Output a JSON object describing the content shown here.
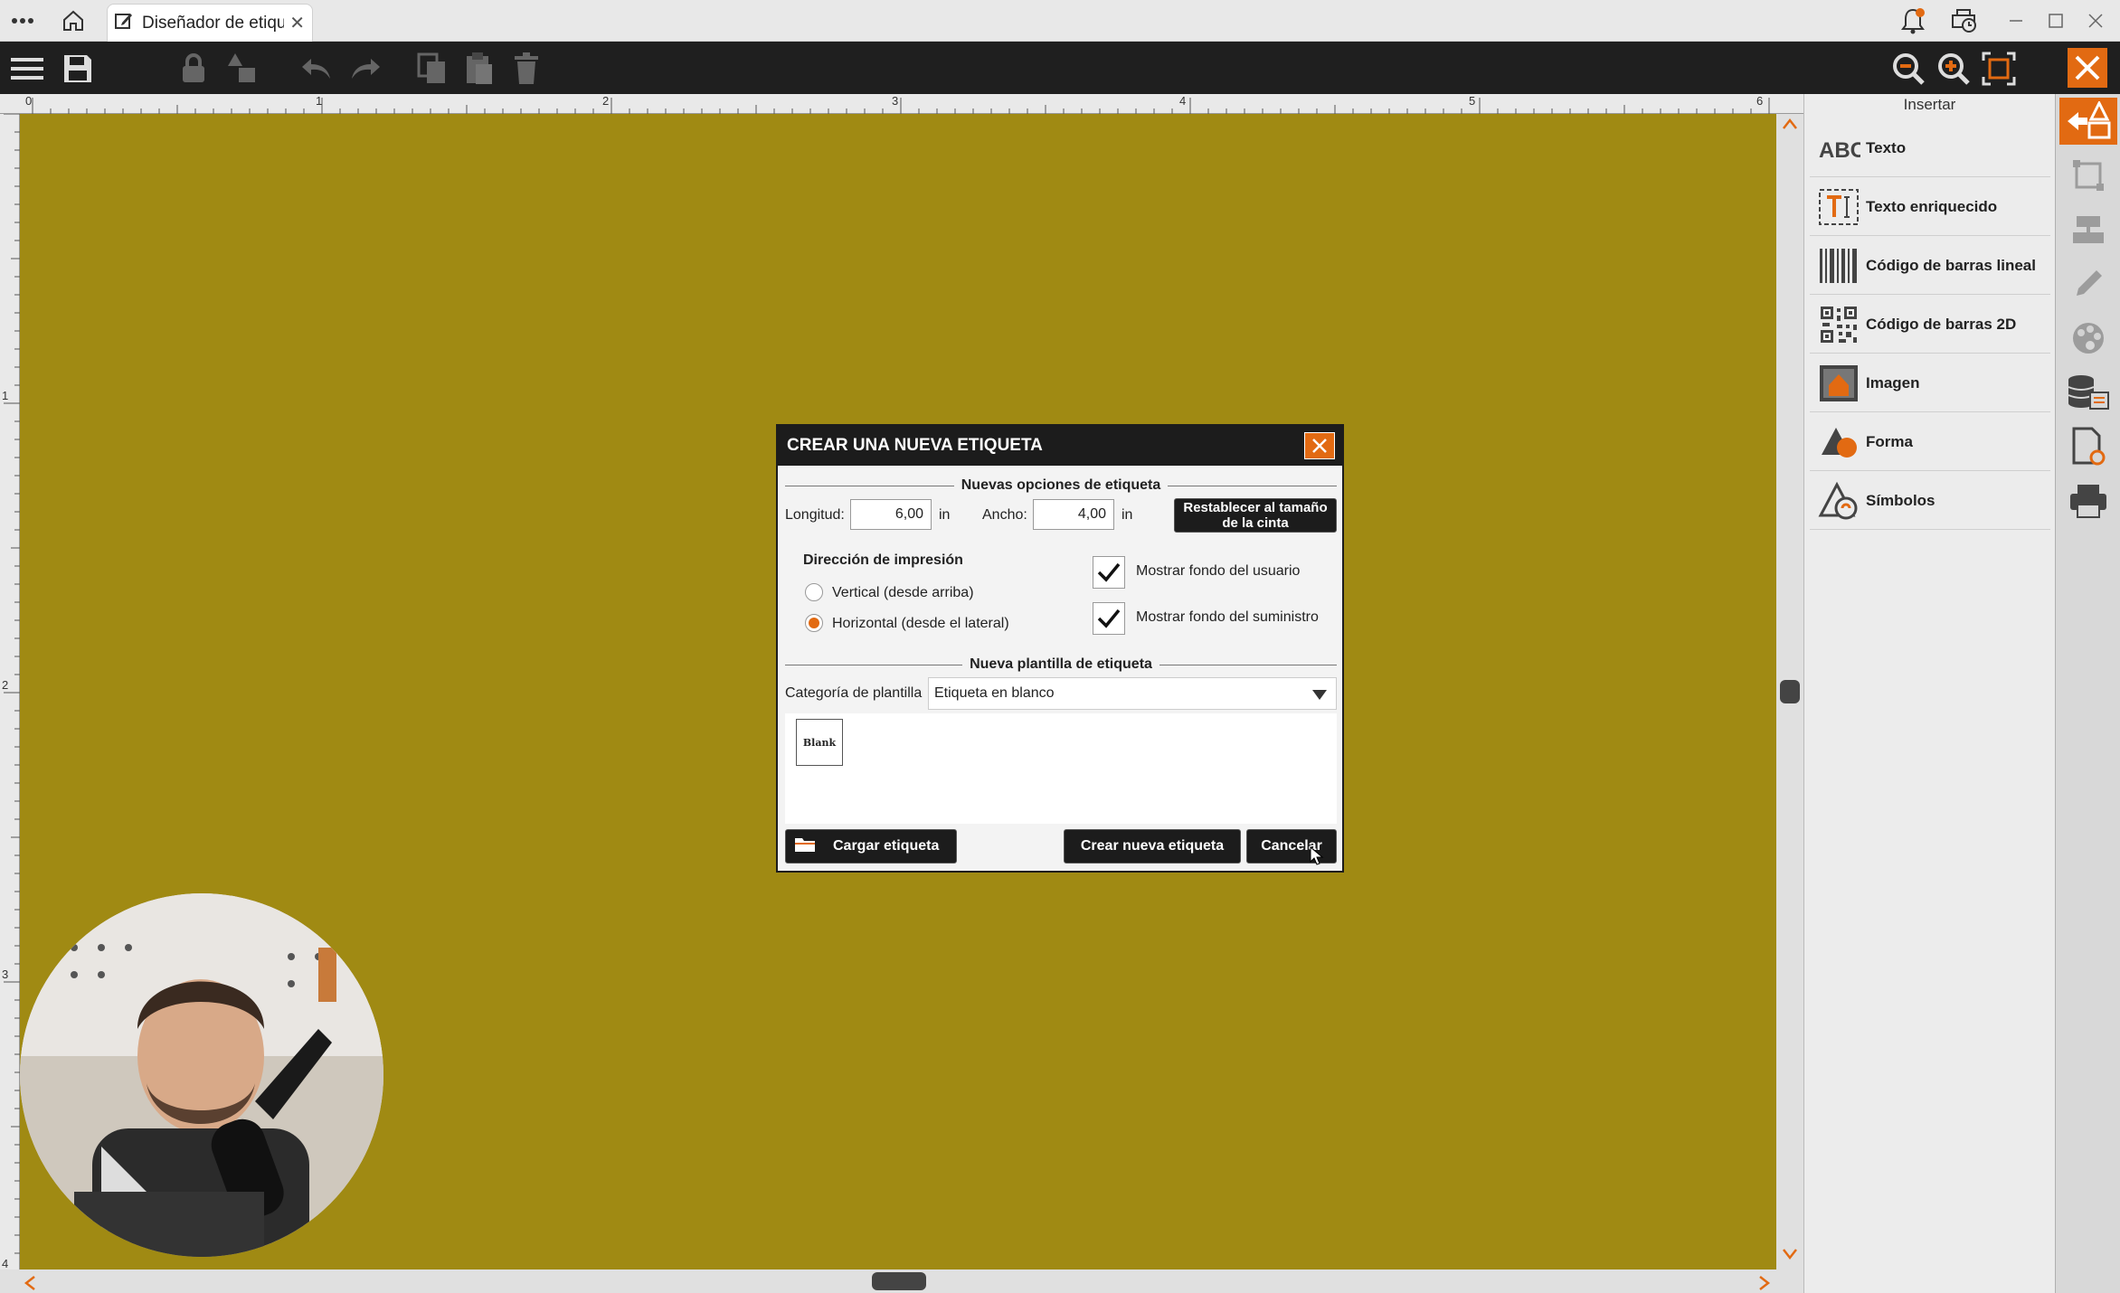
{
  "window": {
    "tab_title": "Diseñador de etique",
    "icons": [
      "more-icon",
      "home-icon",
      "edit-icon",
      "bell-icon",
      "printer-status-icon",
      "minimize-icon",
      "maximize-icon",
      "close-icon"
    ]
  },
  "toolbar": {
    "icons": [
      "menu-icon",
      "save-icon",
      "lock-icon",
      "group-icon",
      "undo-icon",
      "redo-icon",
      "copy-icon",
      "paste-icon",
      "delete-icon",
      "zoom-out-icon",
      "zoom-in-icon",
      "fit-icon",
      "close-designer-icon"
    ]
  },
  "ruler": {
    "h_ticks": [
      "0",
      "1",
      "2",
      "3",
      "4",
      "5",
      "6"
    ],
    "v_ticks": [
      "1",
      "2",
      "3",
      "4"
    ]
  },
  "insert_panel": {
    "title": "Insertar",
    "items": [
      {
        "label": "Texto",
        "icon": "text-abc-icon"
      },
      {
        "label": "Texto enriquecido",
        "icon": "rich-text-icon"
      },
      {
        "label": "Código de barras lineal",
        "icon": "linear-barcode-icon"
      },
      {
        "label": "Código de barras 2D",
        "icon": "qr-code-icon"
      },
      {
        "label": "Imagen",
        "icon": "image-icon"
      },
      {
        "label": "Forma",
        "icon": "shape-icon"
      },
      {
        "label": "Símbolos",
        "icon": "symbols-icon"
      }
    ]
  },
  "right_sidebar": {
    "icons": [
      "insert-icon",
      "crop-icon",
      "align-icon",
      "pencil-icon",
      "palette-icon",
      "database-icon",
      "document-settings-icon",
      "print-icon"
    ]
  },
  "dialog": {
    "title": "CREAR UNA NUEVA ETIQUETA",
    "options_section": "Nuevas opciones de etiqueta",
    "length_label": "Longitud:",
    "length_value": "6,00",
    "width_label": "Ancho:",
    "width_value": "4,00",
    "unit": "in",
    "reset_button": "Restablecer al tamaño de la cinta",
    "print_direction_label": "Dirección de impresión",
    "radio_vertical": "Vertical (desde arriba)",
    "radio_horizontal": "Horizontal (desde el lateral)",
    "selected_direction": "horizontal",
    "show_user_bg": "Mostrar fondo del usuario",
    "show_supply_bg": "Mostrar fondo del suministro",
    "show_user_bg_checked": true,
    "show_supply_bg_checked": true,
    "template_section": "Nueva plantilla de etiqueta",
    "category_label": "Categoría de plantilla",
    "category_value": "Etiqueta en blanco",
    "template_tile": "Blank",
    "load_button": "Cargar etiqueta",
    "create_button": "Crear nueva etiqueta",
    "cancel_button": "Cancelar"
  },
  "colors": {
    "canvas": "#a08a13",
    "accent": "#e26a12",
    "dark": "#1c1c1c"
  }
}
